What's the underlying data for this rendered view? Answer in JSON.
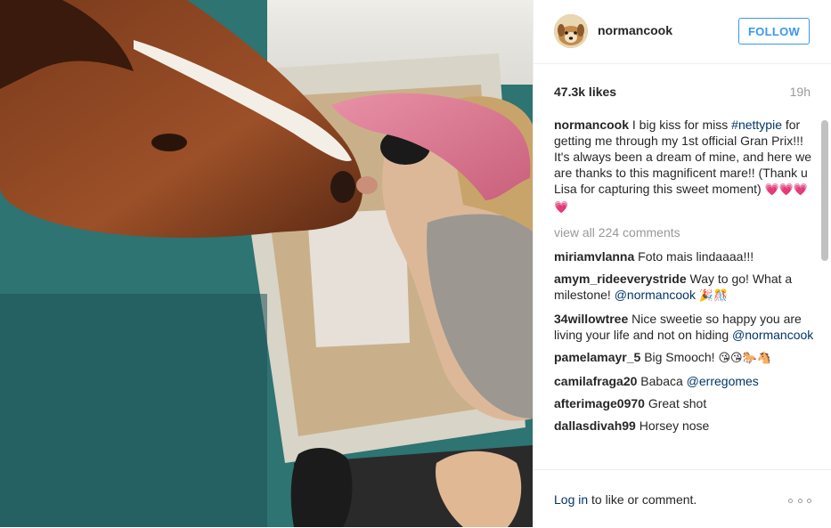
{
  "post": {
    "image_alt": "Photo by normancook",
    "user": {
      "username": "normancook"
    },
    "follow_label": "FOLLOW",
    "likes": "47.3k likes",
    "time_ago": "19h",
    "caption": {
      "author": "normancook",
      "text_1": "I big kiss for miss ",
      "hashtag": "#nettypie",
      "text_2": " for getting me through my 1st official Gran Prix!!! It's always been a dream of mine, and here we are thanks to this magnificent mare!! (Thank u Lisa for capturing this sweet moment) ",
      "emoji": "💗💗💗💗"
    },
    "view_all": "view all 224 comments",
    "comments": [
      {
        "author": "miriamvlanna",
        "text": "Foto mais lindaaaa!!!"
      },
      {
        "author": "amym_rideeverystride",
        "text": "Way to go! What a milestone! ",
        "mention": "@normancook",
        "emoji": "🎉🎊"
      },
      {
        "author": "34willowtree",
        "text": "Nice sweetie so happy you are living your life and not on hiding ",
        "mention": "@normancook"
      },
      {
        "author": "pamelamayr_5",
        "text": "Big Smooch! ",
        "emoji": "😘😘🐎🐴"
      },
      {
        "author": "camilafraga20",
        "text": "Babaca ",
        "mention": "@erregomes"
      },
      {
        "author": "afterimage0970",
        "text": "Great shot"
      },
      {
        "author": "dallasdivah99",
        "text": "Horsey nose"
      }
    ],
    "footer": {
      "login_link": "Log in",
      "login_rest": " to like or comment."
    }
  },
  "colors": {
    "accent": "#3897f0",
    "link": "#003569",
    "muted": "#999999",
    "text": "#262626"
  },
  "icons": {
    "more": "more-options-icon"
  }
}
